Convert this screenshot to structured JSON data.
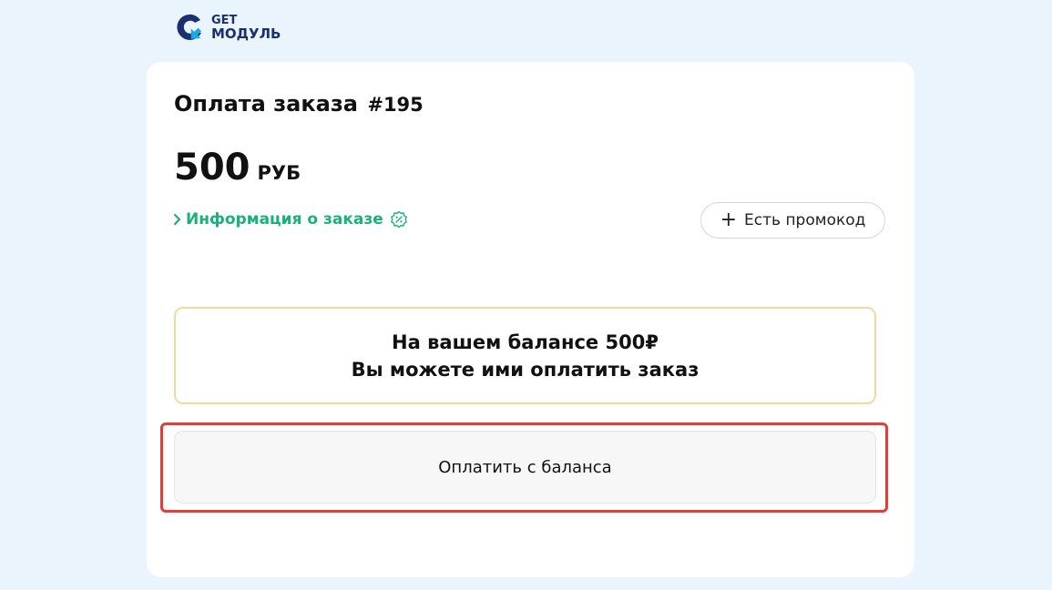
{
  "logo": {
    "line1": "GET",
    "line2": "МОДУЛЬ",
    "accent_color": "#1c2f6e",
    "arrow_color": "#1aa8e0"
  },
  "order": {
    "title": "Оплата заказа",
    "number": "#195",
    "amount": "500",
    "currency": "РУБ"
  },
  "info_link": {
    "label": "Информация о заказе",
    "color": "#1bb07a"
  },
  "promo": {
    "label": "Есть промокод"
  },
  "balance": {
    "line1": "На вашем балансе 500₽",
    "line2": "Вы можете ими оплатить заказ"
  },
  "pay_button": {
    "label": "Оплатить с баланса"
  }
}
